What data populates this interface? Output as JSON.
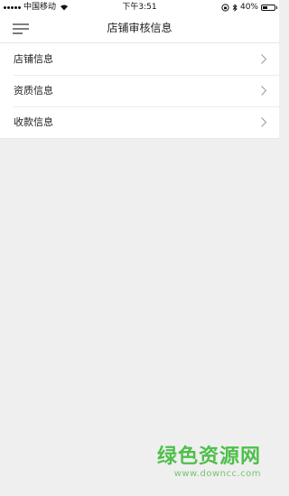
{
  "status_bar": {
    "carrier": "中国移动",
    "time": "下午3:51",
    "battery_percent": "40%",
    "battery_level": 0.4,
    "icons": [
      "signal-icon",
      "wifi-icon",
      "rotation-lock-icon",
      "bluetooth-icon",
      "battery-icon"
    ]
  },
  "nav": {
    "title": "店铺审核信息",
    "menu_icon": "hamburger-menu-icon"
  },
  "list": {
    "items": [
      {
        "label": "店铺信息"
      },
      {
        "label": "资质信息"
      },
      {
        "label": "收款信息"
      }
    ]
  },
  "watermark": {
    "title": "绿色资源网",
    "url": "www.downcc.com"
  },
  "colors": {
    "background": "#efefef",
    "surface": "#ffffff",
    "watermark": "#4fbf4b"
  }
}
